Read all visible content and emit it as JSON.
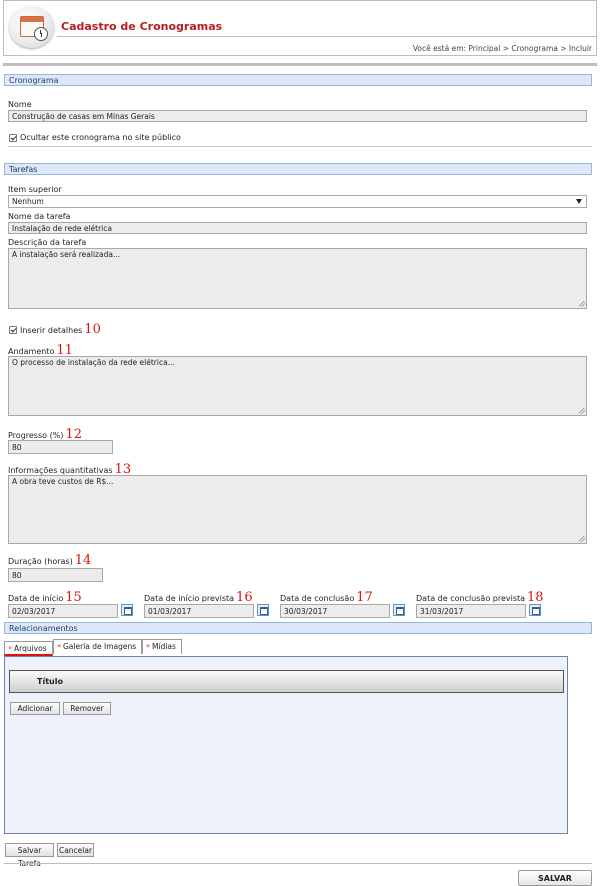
{
  "header": {
    "title": "Cadastro de Cronogramas",
    "breadcrumb": "Você está em: Principal > Cronograma > Incluir"
  },
  "cronograma": {
    "section_title": "Cronograma",
    "nome_label": "Nome",
    "nome_value": "Construção de casas em Minas Gerais",
    "ocultar_label": "Ocultar este cronograma no site público"
  },
  "tarefas": {
    "section_title": "Tarefas",
    "item_superior_label": "Item superior",
    "item_superior_value": "Nenhum",
    "nome_tarefa_label": "Nome da tarefa",
    "nome_tarefa_value": "Instalação de rede elétrica",
    "descricao_label": "Descrição da tarefa",
    "descricao_value": "A instalação será realizada...",
    "inserir_detalhes_label": "Inserir detalhes",
    "inserir_detalhes_num": "10",
    "andamento_label": "Andamento",
    "andamento_num": "11",
    "andamento_value": "O processo de instalação da rede elétrica...",
    "progresso_label": "Progresso (%)",
    "progresso_num": "12",
    "progresso_value": "80",
    "info_quant_label": "Informações quantitativas",
    "info_quant_num": "13",
    "info_quant_value": "A obra teve custos de R$...",
    "duracao_label": "Duração (horas)",
    "duracao_num": "14",
    "duracao_value": "80",
    "data_inicio_label": "Data de início",
    "data_inicio_num": "15",
    "data_inicio_value": "02/03/2017",
    "data_inicio_prevista_label": "Data de início prevista",
    "data_inicio_prevista_num": "16",
    "data_inicio_prevista_value": "01/03/2017",
    "data_conclusao_label": "Data de conclusão",
    "data_conclusao_num": "17",
    "data_conclusao_value": "30/03/2017",
    "data_conclusao_prevista_label": "Data de conclusão prevista",
    "data_conclusao_prevista_num": "18",
    "data_conclusao_prevista_value": "31/03/2017"
  },
  "relacionamentos": {
    "section_title": "Relacionamentos",
    "tabs": [
      "Arquivos",
      "Galeria de Imagens",
      "Mídias"
    ],
    "table_header": "Título",
    "adicionar": "Adicionar",
    "remover": "Remover"
  },
  "actions": {
    "salvar_tarefa": "Salvar Tarefa",
    "cancelar": "Cancelar",
    "salvar": "SALVAR"
  }
}
